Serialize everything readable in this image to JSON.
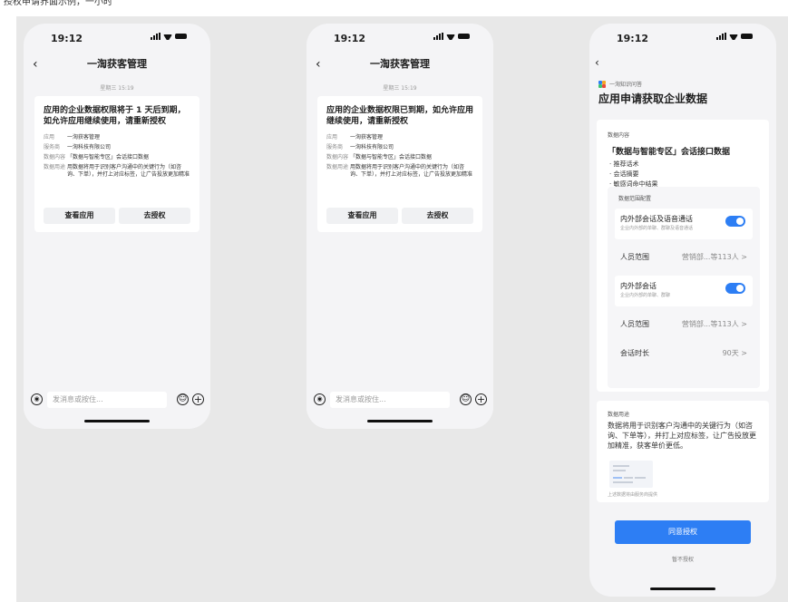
{
  "caption": "授权申请界面示例，一小时",
  "phones": [
    {
      "time": "19:12",
      "nav_title": "一渹获客管理",
      "timestamp": "星期三 15:19",
      "card_title": "应用的企业数据权限将于 1 天后到期，如允许应用继续使用，请重新授权",
      "rows": [
        {
          "label": "应用",
          "value": "一渹获客管理"
        },
        {
          "label": "服务商",
          "value": "一渹科技有限公司"
        },
        {
          "label": "数据内容",
          "value": "「数据与智能专区」会话接口数据"
        },
        {
          "label": "数据用途",
          "value": "用数据将用于识别客户沟通中的关键行为（如咨询、下单），并打上对应标签，让广告投放更加精准"
        }
      ],
      "btn_view": "查看应用",
      "btn_auth": "去授权",
      "input_placeholder": "发消息或按住..."
    },
    {
      "time": "19:12",
      "nav_title": "一渹获客管理",
      "timestamp": "星期三 15:19",
      "card_title": "应用的企业数据权限已到期，如允许应用继续使用，请重新授权",
      "rows": [
        {
          "label": "应用",
          "value": "一渹获客管理"
        },
        {
          "label": "服务商",
          "value": "一渹科技有限公司"
        },
        {
          "label": "数据内容",
          "value": "「数据与智能专区」会话接口数据"
        },
        {
          "label": "数据用途",
          "value": "用数据将用于识别客户沟通中的关键行为（如咨询、下单），并打上对应标签，让广告投放更加精准"
        }
      ],
      "btn_view": "查看应用",
      "btn_auth": "去授权",
      "input_placeholder": "发消息或按住..."
    }
  ],
  "phone3": {
    "time": "19:12",
    "source": "一渹知识问答",
    "title": "应用申请获取企业数据",
    "data_content_label": "数据内容",
    "data_title": "「数据与智能专区」会话接口数据",
    "bullets": [
      "· 推荐话术",
      "· 会话摘要",
      "· 敏感词命中结果"
    ],
    "config_label": "数据范围配置",
    "opt1_title": "内外部会话及语音通话",
    "opt1_sub": "企业内外部的单聊、群聊及语音通话",
    "range1_key": "人员范围",
    "range1_val": "营销部...等113人 >",
    "opt2_title": "内外部会话",
    "opt2_sub": "企业内外部的单聊、群聊",
    "range2_key": "人员范围",
    "range2_val": "营销部...等113人 >",
    "duration_key": "会话时长",
    "duration_val": "90天 >",
    "use_label": "数据用途",
    "use_text": "数据将用于识别客户沟通中的关键行为（如咨询、下单等），并打上对应标签，让广告投放更加精准，获客单价更低。",
    "note": "上述数据将由服务商提供",
    "agree": "同意授权",
    "deny": "暂不授权"
  },
  "colors": {
    "accent": "#2d7ef4",
    "canvas": "#e8e8e8",
    "phone_bg": "#f4f4f6"
  }
}
